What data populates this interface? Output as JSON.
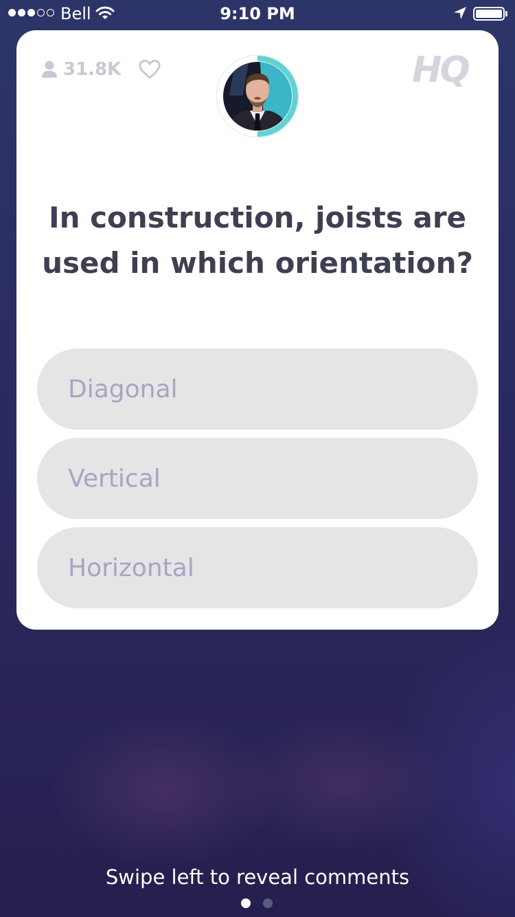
{
  "status_bar": {
    "signal_bars_filled": 3,
    "signal_bars_total": 5,
    "carrier": "Bell",
    "time": "9:10 PM",
    "battery_level": 1.0
  },
  "card": {
    "viewer_count": "31.8K",
    "logo_text": "HQ",
    "question": "In construction, joists are used in which orientation?",
    "answers": [
      {
        "label": "Diagonal"
      },
      {
        "label": "Vertical"
      },
      {
        "label": "Horizontal"
      }
    ],
    "countdown_progress": 0.5,
    "colors": {
      "card_background": "#ffffff",
      "question_text": "#3f3f52",
      "answer_background": "#e5e5e5",
      "answer_text": "#a7a4c4",
      "countdown_ring": "#5fd3d3",
      "logo": "#d6d5df"
    }
  },
  "footer": {
    "swipe_hint": "Swipe left to reveal comments",
    "page_count": 2,
    "active_page": 1
  },
  "icons": [
    "user-icon",
    "heart-icon",
    "wifi-icon",
    "location-arrow-icon",
    "battery-icon"
  ]
}
